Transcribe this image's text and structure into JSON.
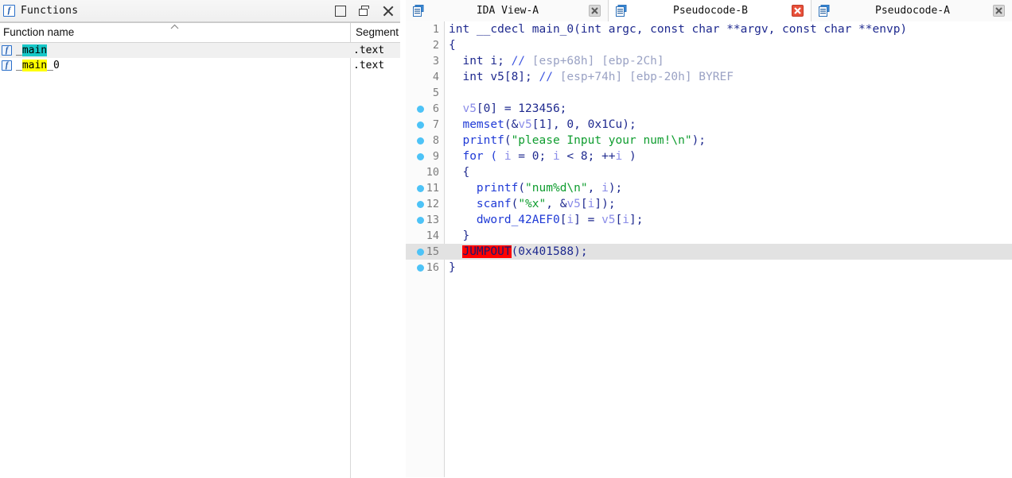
{
  "functions_panel": {
    "icon": "function-f-icon",
    "title": "Functions",
    "window_buttons": [
      {
        "name": "restore-button",
        "glyph": "restore"
      },
      {
        "name": "cascade-button",
        "glyph": "cascade"
      },
      {
        "name": "close-button",
        "glyph": "close"
      }
    ],
    "columns": [
      {
        "label": "Function name",
        "sort": "ascending"
      },
      {
        "label": "Segment"
      }
    ],
    "rows": [
      {
        "icon": "function-f-icon",
        "prefix": "_",
        "highlight_text": "main",
        "highlight_color": "#18c8c8",
        "suffix": "",
        "segment": ".text",
        "selected": true
      },
      {
        "icon": "function-f-icon",
        "prefix": "_",
        "highlight_text": "main",
        "highlight_color": "#ffff00",
        "suffix": "_0",
        "segment": ".text",
        "selected": false
      }
    ]
  },
  "tabs": [
    {
      "label": "IDA View-A",
      "icon": "document-icon",
      "close": "close-icon",
      "active": false,
      "close_style": "gray"
    },
    {
      "label": "Pseudocode-B",
      "icon": "document-icon",
      "close": "close-icon",
      "active": true,
      "close_style": "red"
    },
    {
      "label": "Pseudocode-A",
      "icon": "document-icon",
      "close": "close-icon",
      "active": false,
      "close_style": "gray"
    }
  ],
  "code": {
    "cursor_line": 15,
    "lines": [
      {
        "n": "1",
        "bp": false,
        "hl": false
      },
      {
        "n": "2",
        "bp": false,
        "hl": false
      },
      {
        "n": "3",
        "bp": false,
        "hl": false
      },
      {
        "n": "4",
        "bp": false,
        "hl": false
      },
      {
        "n": "5",
        "bp": false,
        "hl": false
      },
      {
        "n": "6",
        "bp": true,
        "hl": false
      },
      {
        "n": "7",
        "bp": true,
        "hl": false
      },
      {
        "n": "8",
        "bp": true,
        "hl": false
      },
      {
        "n": "9",
        "bp": true,
        "hl": false
      },
      {
        "n": "10",
        "bp": false,
        "hl": false
      },
      {
        "n": "11",
        "bp": true,
        "hl": false
      },
      {
        "n": "12",
        "bp": true,
        "hl": false
      },
      {
        "n": "13",
        "bp": true,
        "hl": false
      },
      {
        "n": "14",
        "bp": false,
        "hl": false
      },
      {
        "n": "15",
        "bp": true,
        "hl": true
      },
      {
        "n": "16",
        "bp": true,
        "hl": false
      }
    ],
    "text": {
      "l1": "int __cdecl main_0(int argc, const char **argv, const char **envp)",
      "l2": "{",
      "l3_a": "  int i; ",
      "l3_m": "//",
      "l3_c": " [esp+68h] [ebp-2Ch]",
      "l4_a": "  int v5[8]; ",
      "l4_m": "//",
      "l4_c": " [esp+74h] [ebp-20h] BYREF",
      "l5": "",
      "l6_v": "  v5",
      "l6_r": "[0] = 123456;",
      "l7_f": "  memset",
      "l7_a": "(&",
      "l7_v": "v5",
      "l7_b": "[1], 0, 0x1Cu);",
      "l8_f": "  printf",
      "l8_a": "(",
      "l8_s": "\"please Input your num!\\n\"",
      "l8_b": ");",
      "l9_a": "  for ( ",
      "l9_i": "i",
      "l9_b": " = 0; ",
      "l9_i2": "i",
      "l9_c": " < 8; ++",
      "l9_i3": "i",
      "l9_d": " )",
      "l10": "  {",
      "l11_f": "    printf",
      "l11_a": "(",
      "l11_s": "\"num%d\\n\"",
      "l11_b": ", ",
      "l11_i": "i",
      "l11_c": ");",
      "l12_f": "    scanf",
      "l12_a": "(",
      "l12_s": "\"%x\"",
      "l12_b": ", &",
      "l12_v": "v5",
      "l12_c": "[",
      "l12_i": "i",
      "l12_d": "]);",
      "l13_g": "    dword_42AEF0",
      "l13_a": "[",
      "l13_i": "i",
      "l13_b": "] = ",
      "l13_v": "v5",
      "l13_c": "[",
      "l13_i2": "i",
      "l13_d": "];",
      "l14": "  }",
      "l15_pre": "  ",
      "l15_j": "JUMPOUT",
      "l15_post": "(0x401588);",
      "l16": "}"
    }
  },
  "colors": {
    "keyword": "#1f2a8f",
    "function": "#1f3ad6",
    "variable": "#8a8ce8",
    "string": "#0f9d2f",
    "comment": "#9aa2c4",
    "jumpout_bg": "#ff0000",
    "breakpoint": "#4dc3f7",
    "line_highlight": "#e2e2e2",
    "cyan_highlight": "#18c8c8",
    "yellow_highlight": "#ffff00"
  }
}
